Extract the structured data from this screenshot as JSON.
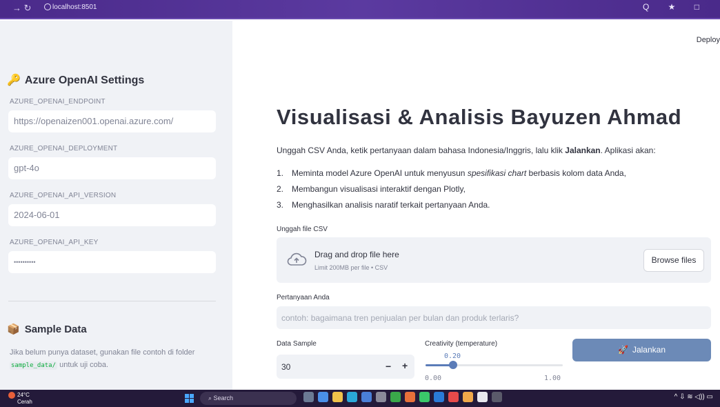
{
  "browser": {
    "url": "localhost:8501",
    "nav_icons": "→ ↻",
    "right_icons": "Q ★ □"
  },
  "sidebar": {
    "title": "Azure OpenAI Settings",
    "title_icon": "key-icon",
    "fields": [
      {
        "label": "AZURE_OPENAI_ENDPOINT",
        "value": "https://openaizen001.openai.azure.com/"
      },
      {
        "label": "AZURE_OPENAI_DEPLOYMENT",
        "value": "gpt-4o"
      },
      {
        "label": "AZURE_OPENAI_API_VERSION",
        "value": "2024-06-01"
      },
      {
        "label": "AZURE_OPENAI_API_KEY",
        "value": "••••••••••"
      }
    ],
    "sample": {
      "title": "Sample Data",
      "icon": "box-icon",
      "text_before": "Jika belum punya dataset, gunakan file contoh di folder",
      "code": "sample_data/",
      "text_after": "untuk uji coba."
    }
  },
  "main": {
    "deploy_label": "Deploy",
    "title": "Visualisasi & Analisis Bayuzen Ahmad",
    "intro_prefix": "Unggah CSV Anda, ketik pertanyaan dalam bahasa Indonesia/Inggris, lalu klik ",
    "intro_bold": "Jalankan",
    "intro_suffix": ". Aplikasi akan:",
    "steps": [
      {
        "num": "1.",
        "before": "Meminta model Azure OpenAI untuk menyusun ",
        "italic": "spesifikasi chart",
        "after": " berbasis kolom data Anda,"
      },
      {
        "num": "2.",
        "before": "Membangun visualisasi interaktif dengan Plotly,",
        "italic": "",
        "after": ""
      },
      {
        "num": "3.",
        "before": "Menghasilkan analisis naratif terkait pertanyaan Anda.",
        "italic": "",
        "after": ""
      }
    ],
    "upload": {
      "label": "Unggah file CSV",
      "title": "Drag and drop file here",
      "subtitle": "Limit 200MB per file • CSV",
      "browse_label": "Browse files"
    },
    "question": {
      "label": "Pertanyaan Anda",
      "placeholder": "contoh: bagaimana tren penjualan per bulan dan produk terlaris?"
    },
    "data_sample": {
      "label": "Data Sample",
      "value": "30",
      "minus": "−",
      "plus": "+"
    },
    "creativity": {
      "label": "Creativity (temperature)",
      "value_text": "0.20",
      "value": 0.2,
      "min": 0,
      "max": 1,
      "min_text": "0.00",
      "max_text": "1.00"
    },
    "run_button": {
      "icon": "rocket-icon",
      "label": "Jalankan"
    }
  },
  "taskbar": {
    "weather_temp": "24°C",
    "weather_desc": "Cerah",
    "search_label": "Search",
    "tray": "^ ⇩ ≋ ◁)) ▭"
  },
  "colors": {
    "accent": "#6c8ab7",
    "slider": "#5b7cb8",
    "sidebar_bg": "#f0f2f6",
    "browser_bar": "#4a2a8a"
  }
}
